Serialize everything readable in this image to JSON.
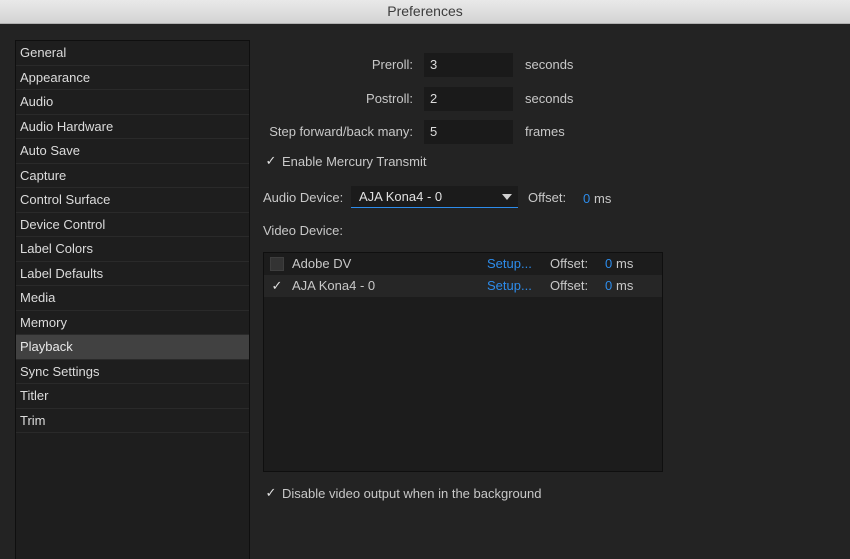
{
  "window": {
    "title": "Preferences"
  },
  "sidebar": {
    "items": [
      {
        "label": "General"
      },
      {
        "label": "Appearance"
      },
      {
        "label": "Audio"
      },
      {
        "label": "Audio Hardware"
      },
      {
        "label": "Auto Save"
      },
      {
        "label": "Capture"
      },
      {
        "label": "Control Surface"
      },
      {
        "label": "Device Control"
      },
      {
        "label": "Label Colors"
      },
      {
        "label": "Label Defaults"
      },
      {
        "label": "Media"
      },
      {
        "label": "Memory"
      },
      {
        "label": "Playback"
      },
      {
        "label": "Sync Settings"
      },
      {
        "label": "Titler"
      },
      {
        "label": "Trim"
      }
    ],
    "selected": "Playback"
  },
  "playback": {
    "preroll": {
      "label": "Preroll:",
      "value": "3",
      "unit": "seconds"
    },
    "postroll": {
      "label": "Postroll:",
      "value": "2",
      "unit": "seconds"
    },
    "step": {
      "label": "Step forward/back many:",
      "value": "5",
      "unit": "frames"
    },
    "mercury": {
      "label": "Enable Mercury Transmit",
      "checked": true,
      "check_glyph": "✓"
    },
    "audio_device": {
      "label": "Audio Device:",
      "selected": "AJA Kona4 - 0",
      "offset_label": "Offset:",
      "offset_value": "0",
      "offset_unit": "ms"
    },
    "video_device_label": "Video Device:",
    "video_devices": [
      {
        "name": "Adobe DV",
        "checked": false,
        "check_glyph": "",
        "setup": "Setup...",
        "offset_label": "Offset:",
        "offset_value": "0",
        "offset_unit": "ms"
      },
      {
        "name": "AJA Kona4 - 0",
        "checked": true,
        "check_glyph": "✓",
        "setup": "Setup...",
        "offset_label": "Offset:",
        "offset_value": "0",
        "offset_unit": "ms"
      }
    ],
    "disable_bg": {
      "label": "Disable video output when in the background",
      "checked": true,
      "check_glyph": "✓"
    }
  },
  "colors": {
    "accent": "#2d8ceb",
    "selected_row": "#414141"
  }
}
